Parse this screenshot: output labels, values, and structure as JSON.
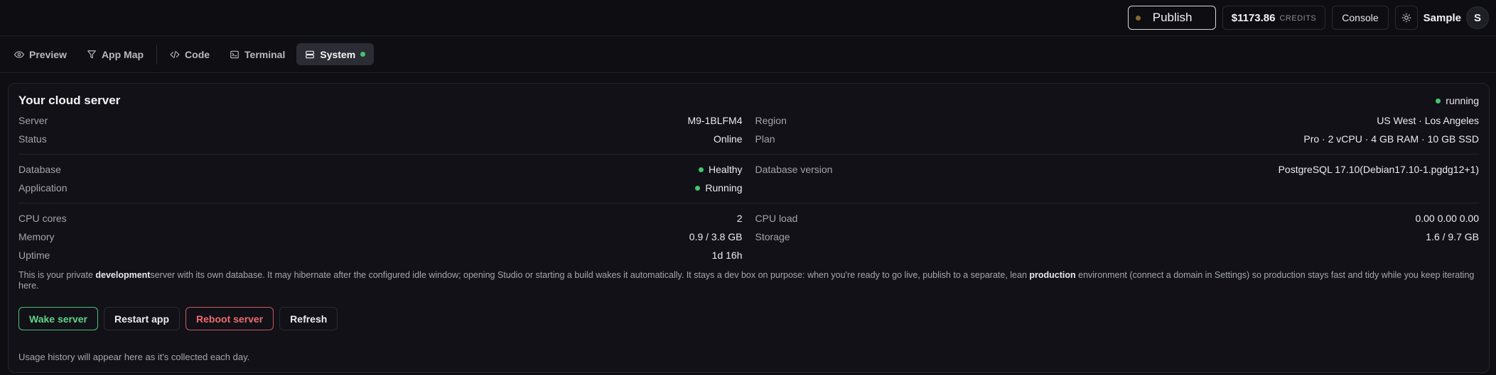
{
  "topbar": {
    "publish_label": "Publish",
    "credits_amount": "$1173.86",
    "credits_label": "CREDITS",
    "console_label": "Console",
    "theme_icon": "sun-icon",
    "user_name": "Sample",
    "avatar_initial": "S"
  },
  "tabs": [
    {
      "label": "Preview",
      "icon": "eye-icon"
    },
    {
      "label": "App Map",
      "icon": "map-icon"
    },
    {
      "label": "Code",
      "icon": "code-icon"
    },
    {
      "label": "Terminal",
      "icon": "terminal-icon"
    },
    {
      "label": "System",
      "icon": "server-icon",
      "active": true
    }
  ],
  "card": {
    "title": "Your cloud server",
    "status": "running",
    "section1": {
      "left": [
        {
          "key": "Server",
          "value": "M9-1BLFM4"
        },
        {
          "key": "Status",
          "value": "Online"
        }
      ],
      "right": [
        {
          "key": "Region",
          "value": "US West · Los Angeles"
        },
        {
          "key": "Plan",
          "value": "Pro · 2 vCPU · 4 GB RAM · 10 GB SSD"
        }
      ]
    },
    "section2": {
      "left": [
        {
          "key": "Database",
          "value": "Healthy"
        },
        {
          "key": "Application",
          "value": "Running"
        }
      ],
      "right": [
        {
          "key": "Database version",
          "value": "PostgreSQL 17.10(Debian17.10-1.pgdg12+1)"
        }
      ]
    },
    "section3": {
      "left": [
        {
          "key": "CPU cores",
          "value": "2"
        },
        {
          "key": "Memory",
          "value": "0.9 / 3.8 GB"
        },
        {
          "key": "Uptime",
          "value": "1d 16h"
        }
      ],
      "right": [
        {
          "key": "CPU load",
          "value": "0.00 0.00 0.00"
        },
        {
          "key": "Storage",
          "value": "1.6 / 9.7 GB"
        }
      ]
    },
    "description": {
      "part1": "This is your private ",
      "bold1": "development",
      "part2": "server with its own database. It may hibernate after the configured idle window; opening Studio or starting a build wakes it automatically. It stays a dev box on purpose: when you're ready to go live, publish to a separate, lean ",
      "bold2": "production",
      "part3": " environment (connect a domain in Settings) so production stays fast and tidy while you keep iterating here."
    },
    "actions": {
      "wake": "Wake server",
      "restart": "Restart app",
      "reboot": "Reboot server",
      "refresh": "Refresh"
    },
    "usage_note": "Usage history will appear here as it's collected each day."
  },
  "colors": {
    "accent_green": "#46c36f",
    "danger_red": "#ee6d6f",
    "background": "#0e0e13"
  }
}
